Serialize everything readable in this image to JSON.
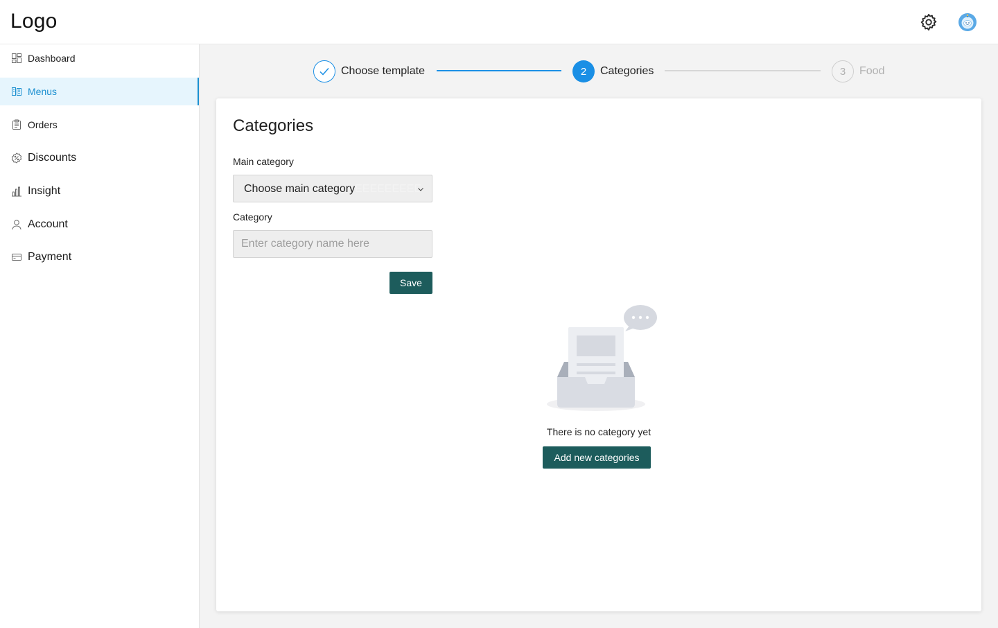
{
  "header": {
    "logo": "Logo",
    "settings_icon": "gear-icon",
    "avatar_icon": "robot-avatar-icon"
  },
  "sidebar": {
    "items": [
      {
        "label": "Dashboard",
        "icon": "dashboard-icon",
        "active": false
      },
      {
        "label": "Menus",
        "icon": "menu-book-icon",
        "active": true
      },
      {
        "label": "Orders",
        "icon": "clipboard-icon",
        "active": false
      },
      {
        "label": "Discounts",
        "icon": "discount-badge-icon",
        "active": false
      },
      {
        "label": "Insight",
        "icon": "bar-chart-icon",
        "active": false
      },
      {
        "label": "Account",
        "icon": "user-icon",
        "active": false
      },
      {
        "label": "Payment",
        "icon": "card-icon",
        "active": false
      }
    ]
  },
  "stepper": {
    "steps": [
      {
        "label": "Choose template",
        "status": "done",
        "number": "1"
      },
      {
        "label": "Categories",
        "status": "current",
        "number": "2"
      },
      {
        "label": "Food",
        "status": "pending",
        "number": "3"
      }
    ]
  },
  "form": {
    "title": "Categories",
    "main_category_label": "Main category",
    "main_category_value": "Choose main category",
    "main_category_overflow": "EEEEEEEEE",
    "category_label": "Category",
    "category_placeholder": "Enter category name here",
    "save_label": "Save"
  },
  "empty_state": {
    "illustration": "empty-inbox-illustration",
    "message": "There is no category yet",
    "add_label": "Add new categories"
  },
  "colors": {
    "accent_blue": "#1a8fe5",
    "primary_button": "#1d5c5c",
    "active_nav_bg": "#e6f5fd",
    "page_bg": "#f3f3f3"
  }
}
